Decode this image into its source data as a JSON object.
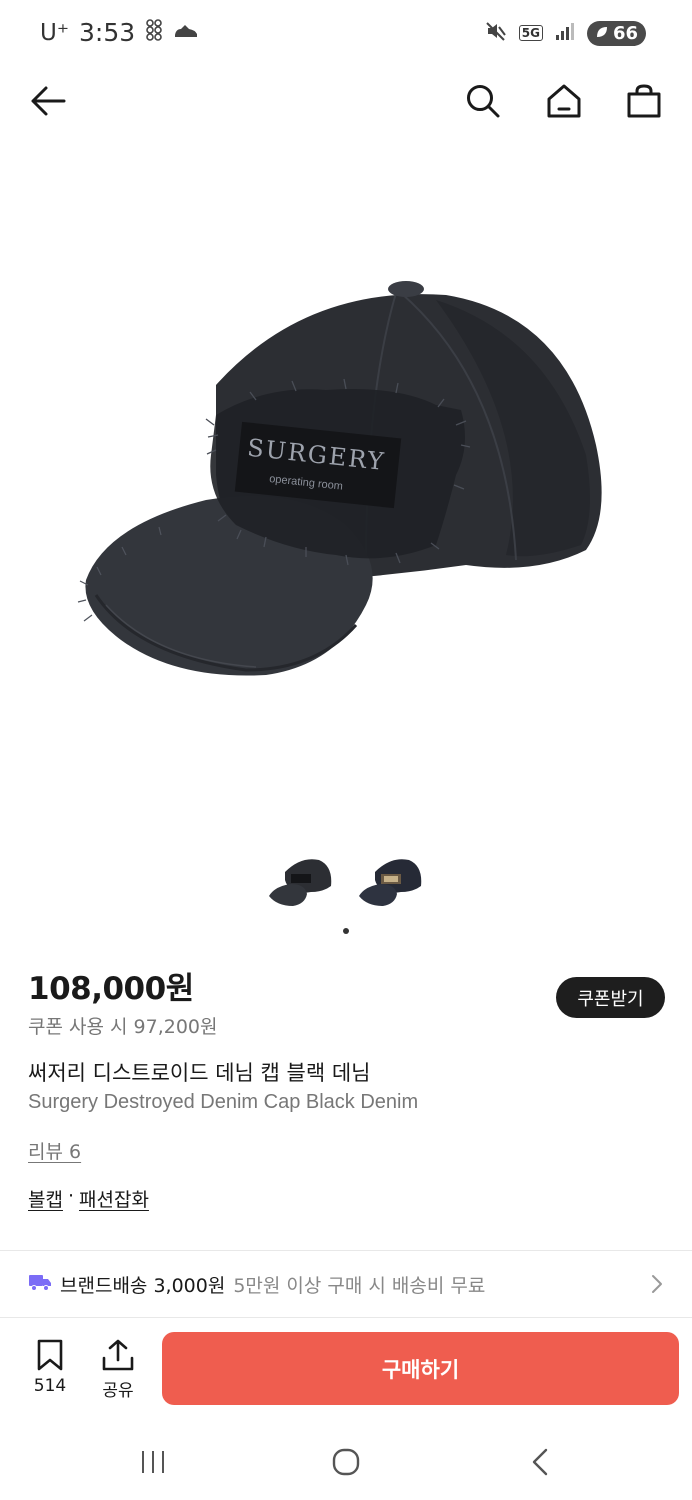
{
  "status_bar": {
    "carrier": "U⁺",
    "time": "3:53",
    "network": "5G",
    "battery": "66"
  },
  "product": {
    "price": "108,000원",
    "coupon_price": "쿠폰 사용 시 97,200원",
    "coupon_button": "쿠폰받기",
    "name_ko": "써저리 디스트로이드 데님 캡 블랙 데님",
    "name_en": "Surgery Destroyed Denim Cap Black Denim",
    "review_link": "리뷰 6",
    "brand": "볼캡",
    "separator": "·",
    "category": "패션잡화",
    "image_logo_text": "SURGERY",
    "image_sub_text": "operating room",
    "gallery": {
      "count": 2,
      "active_index": 0
    }
  },
  "shipping": {
    "main": "브랜드배송 3,000원",
    "sub": "5만원 이상 구매 시 배송비 무료"
  },
  "actions": {
    "bookmark_count": "514",
    "share_label": "공유",
    "buy_label": "구매하기"
  },
  "colors": {
    "buy_button": "#ef5d4f",
    "coupon_button": "#1e1e1e",
    "truck_icon": "#7b6cf6"
  }
}
